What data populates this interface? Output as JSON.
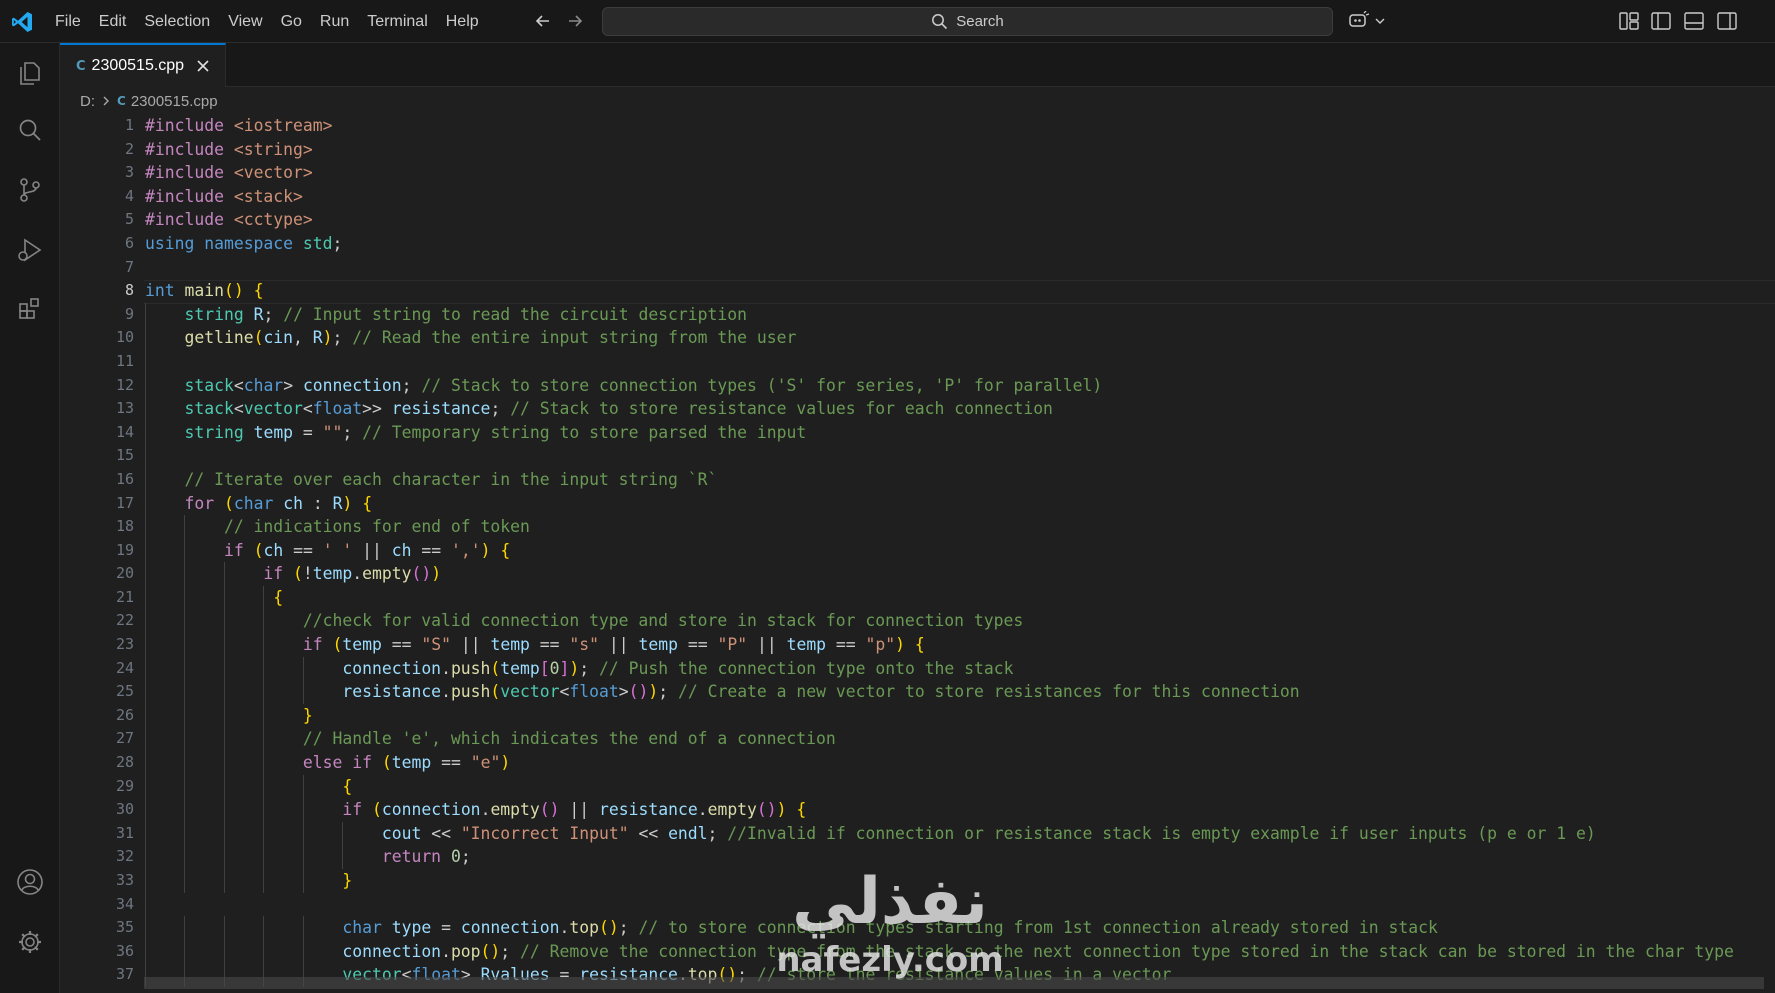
{
  "menu": [
    "File",
    "Edit",
    "Selection",
    "View",
    "Go",
    "Run",
    "Terminal",
    "Help"
  ],
  "search": {
    "label": "Search"
  },
  "tab": {
    "filename": "2300515.cpp",
    "language_glyph": "C"
  },
  "breadcrumb": {
    "drive": "D:",
    "file": "2300515.cpp"
  },
  "editor": {
    "active_line": 8
  },
  "icons": {
    "app": "vscode-logo-icon",
    "activity": [
      "explorer-icon",
      "search-icon",
      "source-control-icon",
      "run-debug-icon",
      "extensions-icon",
      "accounts-icon",
      "manage-gear-icon"
    ],
    "layout": [
      "customize-layout-icon",
      "toggle-primary-sidebar-icon",
      "toggle-panel-icon",
      "toggle-secondary-sidebar-icon"
    ]
  },
  "colors": {
    "keyword": "#569cd6",
    "control": "#c586c0",
    "string": "#ce9178",
    "comment": "#6a9955",
    "type": "#4ec9b0",
    "function": "#dcdcaa",
    "variable": "#9cdcfe",
    "accent": "#0078d4"
  },
  "code_lines": [
    "#include <iostream>",
    "#include <string>",
    "#include <vector>",
    "#include <stack>",
    "#include <cctype>",
    "using namespace std;",
    "",
    "int main() {",
    "    string R; // Input string to read the circuit description",
    "    getline(cin, R); // Read the entire input string from the user",
    "",
    "    stack<char> connection; // Stack to store connection types ('S' for series, 'P' for parallel)",
    "    stack<vector<float>> resistance; // Stack to store resistance values for each connection",
    "    string temp = \"\"; // Temporary string to store parsed the input",
    "",
    "    // Iterate over each character in the input string `R`",
    "    for (char ch : R) {",
    "        // indications for end of token",
    "        if (ch == ' ' || ch == ',') {",
    "            if (!temp.empty())",
    "             {",
    "                //check for valid connection type and store in stack for connection types",
    "                if (temp == \"S\" || temp == \"s\" || temp == \"P\" || temp == \"p\") {",
    "                    connection.push(temp[0]); // Push the connection type onto the stack",
    "                    resistance.push(vector<float>()); // Create a new vector to store resistances for this connection",
    "                }",
    "                // Handle 'e', which indicates the end of a connection",
    "                else if (temp == \"e\")",
    "                    {",
    "                    if (connection.empty() || resistance.empty()) {",
    "                        cout << \"Incorrect Input\" << endl; //Invalid if connection or resistance stack is empty example if user inputs (p e or 1 e)",
    "                        return 0;",
    "                    }",
    "",
    "                    char type = connection.top(); // to store connection types starting from 1st connection already stored in stack",
    "                    connection.pop(); // Remove the connection type from the stack so the next connection type stored in the stack can be stored in the char type",
    "                    vector<float> Rvalues = resistance.top(); // store the resistance values in a vector"
  ],
  "watermark": {
    "arabic": "نفذلي",
    "latin": "nafezly.com"
  }
}
